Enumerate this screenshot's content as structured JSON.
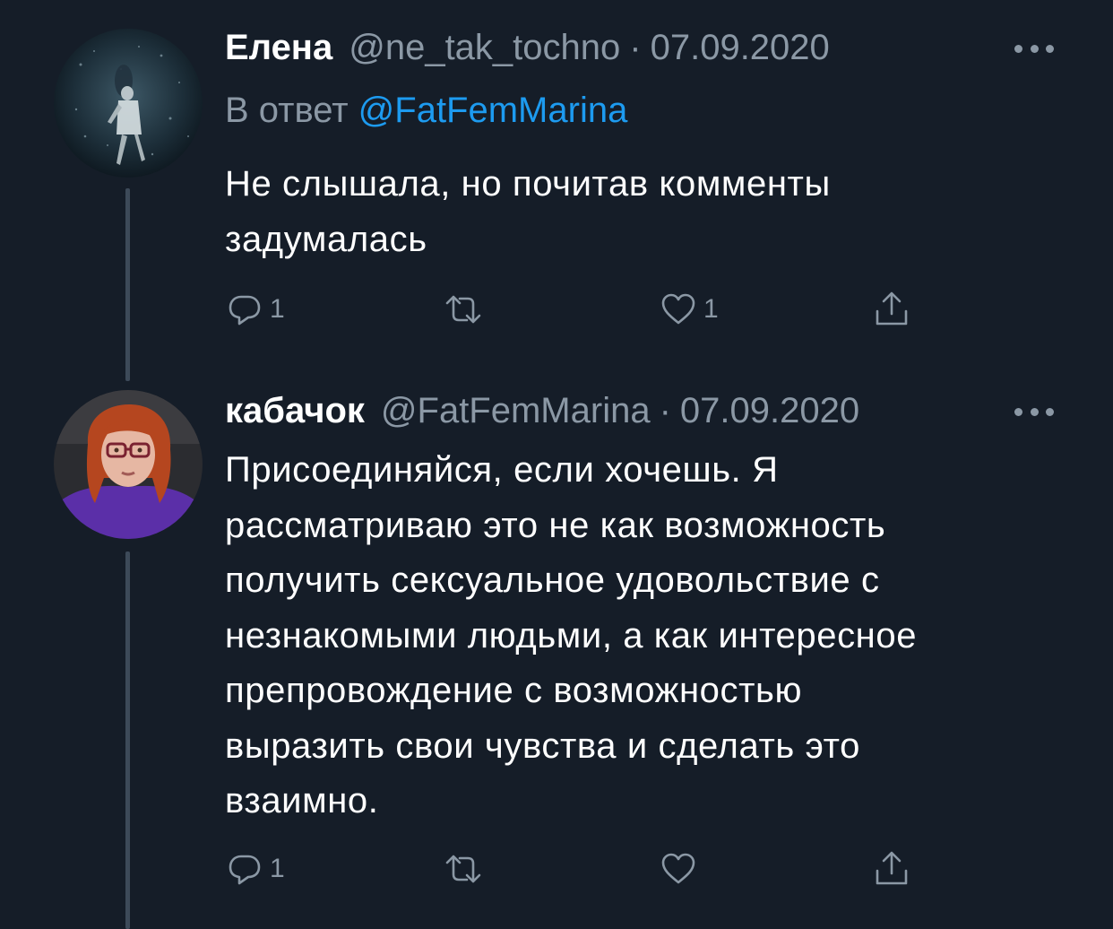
{
  "tweets": [
    {
      "name": "Елена",
      "handle": "@ne_tak_tochno",
      "separator": "·",
      "date": "07.09.2020",
      "reply_prefix": "В ответ",
      "reply_mention": "@FatFemMarina",
      "text_lines": [
        "Не слышала, но почитав комменты",
        "задумалась"
      ],
      "reply_count": "1",
      "retweet_count": "",
      "like_count": "1",
      "avatar_icon": "avatar-underwater-photo"
    },
    {
      "name": "кабачок",
      "handle": "@FatFemMarina",
      "separator": "·",
      "date": "07.09.2020",
      "text_lines": [
        "Присоединяйся, если хочешь. Я",
        "рассматриваю это не как возможность",
        "получить сексуальное удовольствие с",
        "незнакомыми людьми, а как интересное",
        "препровождение с возможностью",
        "выразить свои чувства и сделать это",
        "взаимно."
      ],
      "reply_count": "1",
      "retweet_count": "",
      "like_count": "",
      "avatar_icon": "avatar-woman-red-hair-photo"
    }
  ],
  "icons": {
    "reply": "reply-icon",
    "retweet": "retweet-icon",
    "like": "heart-icon",
    "share": "share-icon",
    "more": "more-icon"
  },
  "colors": {
    "background": "#151d28",
    "text": "#ffffff",
    "secondary": "#8b98a5",
    "link": "#1d9bf0",
    "thread_line": "#3d4a59"
  }
}
